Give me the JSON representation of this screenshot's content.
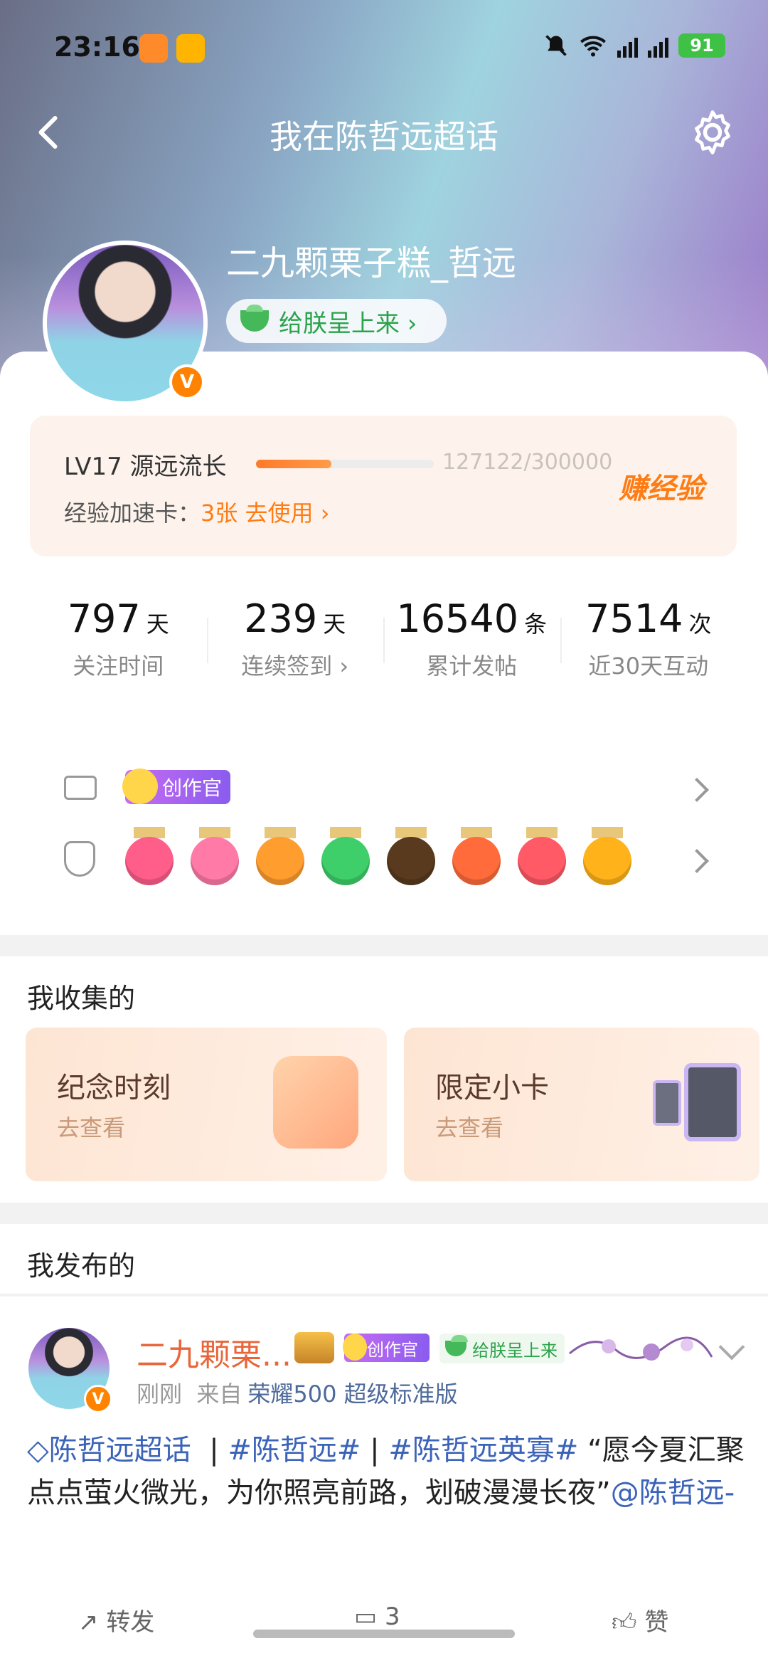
{
  "status_bar": {
    "time": "23:16",
    "battery": "91"
  },
  "nav": {
    "title": "我在陈哲远超话"
  },
  "profile": {
    "nickname": "二九颗栗子糕_哲远",
    "tag": "给朕呈上来 ›",
    "verified": "V"
  },
  "level": {
    "label": "LV17 源远流长",
    "progress": "127122/300000",
    "progress_fraction": 0.424,
    "earn_label": "赚经验",
    "accelerator_prefix": "经验加速卡：",
    "accelerator_link": "3张 去使用 ›"
  },
  "stats": [
    {
      "value": "797",
      "unit": "天",
      "label": "关注时间"
    },
    {
      "value": "239",
      "unit": "天",
      "label": "连续签到 ›"
    },
    {
      "value": "16540",
      "unit": "条",
      "label": "累计发帖"
    },
    {
      "value": "7514",
      "unit": "次",
      "label": "近30天互动"
    }
  ],
  "badges": {
    "creator_label": "创作官",
    "medal_colors": [
      "#ff5d8a",
      "#ff7aa7",
      "#ff9d2e",
      "#3fcf6a",
      "#5a3a1e",
      "#ff6b3a",
      "#ff5a66",
      "#ffb21a"
    ]
  },
  "collections": {
    "title": "我收集的",
    "cards": [
      {
        "title": "纪念时刻",
        "sub": "去查看"
      },
      {
        "title": "限定小卡",
        "sub": "去查看"
      }
    ]
  },
  "posts": {
    "title": "我发布的",
    "item": {
      "author": "二九颗栗...",
      "creator_label": "创作官",
      "tag": "给朕呈上来",
      "time": "刚刚",
      "source_prefix": "来自",
      "source": "荣耀500 超级标准版",
      "topic1": "◇陈哲远超话",
      "topic2": "#陈哲远#",
      "topic3": "#陈哲远英寡#",
      "text": "“愿今夏汇聚点点萤火微光，为你照亮前路，划破漫漫长夜”",
      "mention": "@陈哲远-"
    },
    "actions": {
      "repost": "转发",
      "comment": "3",
      "like": "赞"
    }
  }
}
